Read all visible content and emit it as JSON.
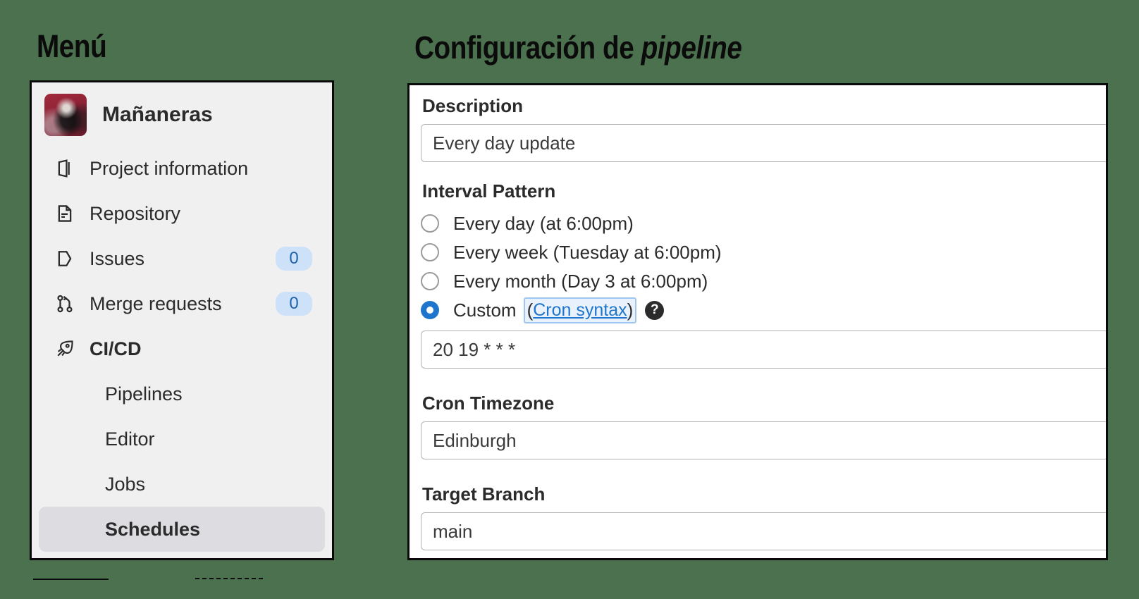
{
  "background_color": "#4b714e",
  "headings": {
    "menu": "Menú",
    "config_prefix": "Configuración de ",
    "config_italic": "pipeline"
  },
  "sidebar": {
    "project": {
      "name": "Mañaneras",
      "avatar": "project-avatar-image"
    },
    "items": [
      {
        "label": "Project information",
        "icon": "project-information-icon",
        "badge": "",
        "active": false,
        "sub": false
      },
      {
        "label": "Repository",
        "icon": "repository-icon",
        "badge": "",
        "active": false,
        "sub": false
      },
      {
        "label": "Issues",
        "icon": "issues-icon",
        "badge": "0",
        "active": false,
        "sub": false
      },
      {
        "label": "Merge requests",
        "icon": "merge-requests-icon",
        "badge": "0",
        "active": false,
        "sub": false
      },
      {
        "label": "CI/CD",
        "icon": "rocket-icon",
        "badge": "",
        "active": false,
        "sub": false,
        "bold": true
      },
      {
        "label": "Pipelines",
        "icon": "",
        "badge": "",
        "active": false,
        "sub": true
      },
      {
        "label": "Editor",
        "icon": "",
        "badge": "",
        "active": false,
        "sub": true
      },
      {
        "label": "Jobs",
        "icon": "",
        "badge": "",
        "active": false,
        "sub": true
      },
      {
        "label": "Schedules",
        "icon": "",
        "badge": "",
        "active": true,
        "sub": true
      }
    ]
  },
  "form": {
    "description": {
      "label": "Description",
      "value": "Every day update",
      "placeholder": ""
    },
    "interval": {
      "label": "Interval Pattern",
      "options": [
        {
          "label": "Every day (at 6:00pm)",
          "selected": false
        },
        {
          "label": "Every week (Tuesday at 6:00pm)",
          "selected": false
        },
        {
          "label": "Every month (Day 3 at 6:00pm)",
          "selected": false
        }
      ],
      "custom": {
        "label": "Custom",
        "open_paren": "(",
        "link": "Cron syntax",
        "close_paren": ")",
        "help_icon": "?",
        "selected": true
      },
      "cron_value": "20 19 * * *"
    },
    "timezone": {
      "label": "Cron Timezone",
      "value": "Edinburgh"
    },
    "branch": {
      "label": "Target Branch",
      "value": "main"
    }
  },
  "colors": {
    "accent_blue": "#1f75cb",
    "badge_bg": "#cde1f8",
    "badge_text": "#1f62ab",
    "active_item_bg": "#dcdce1",
    "panel_border": "#0a0a0a",
    "sidebar_bg": "#f0f0f0"
  }
}
